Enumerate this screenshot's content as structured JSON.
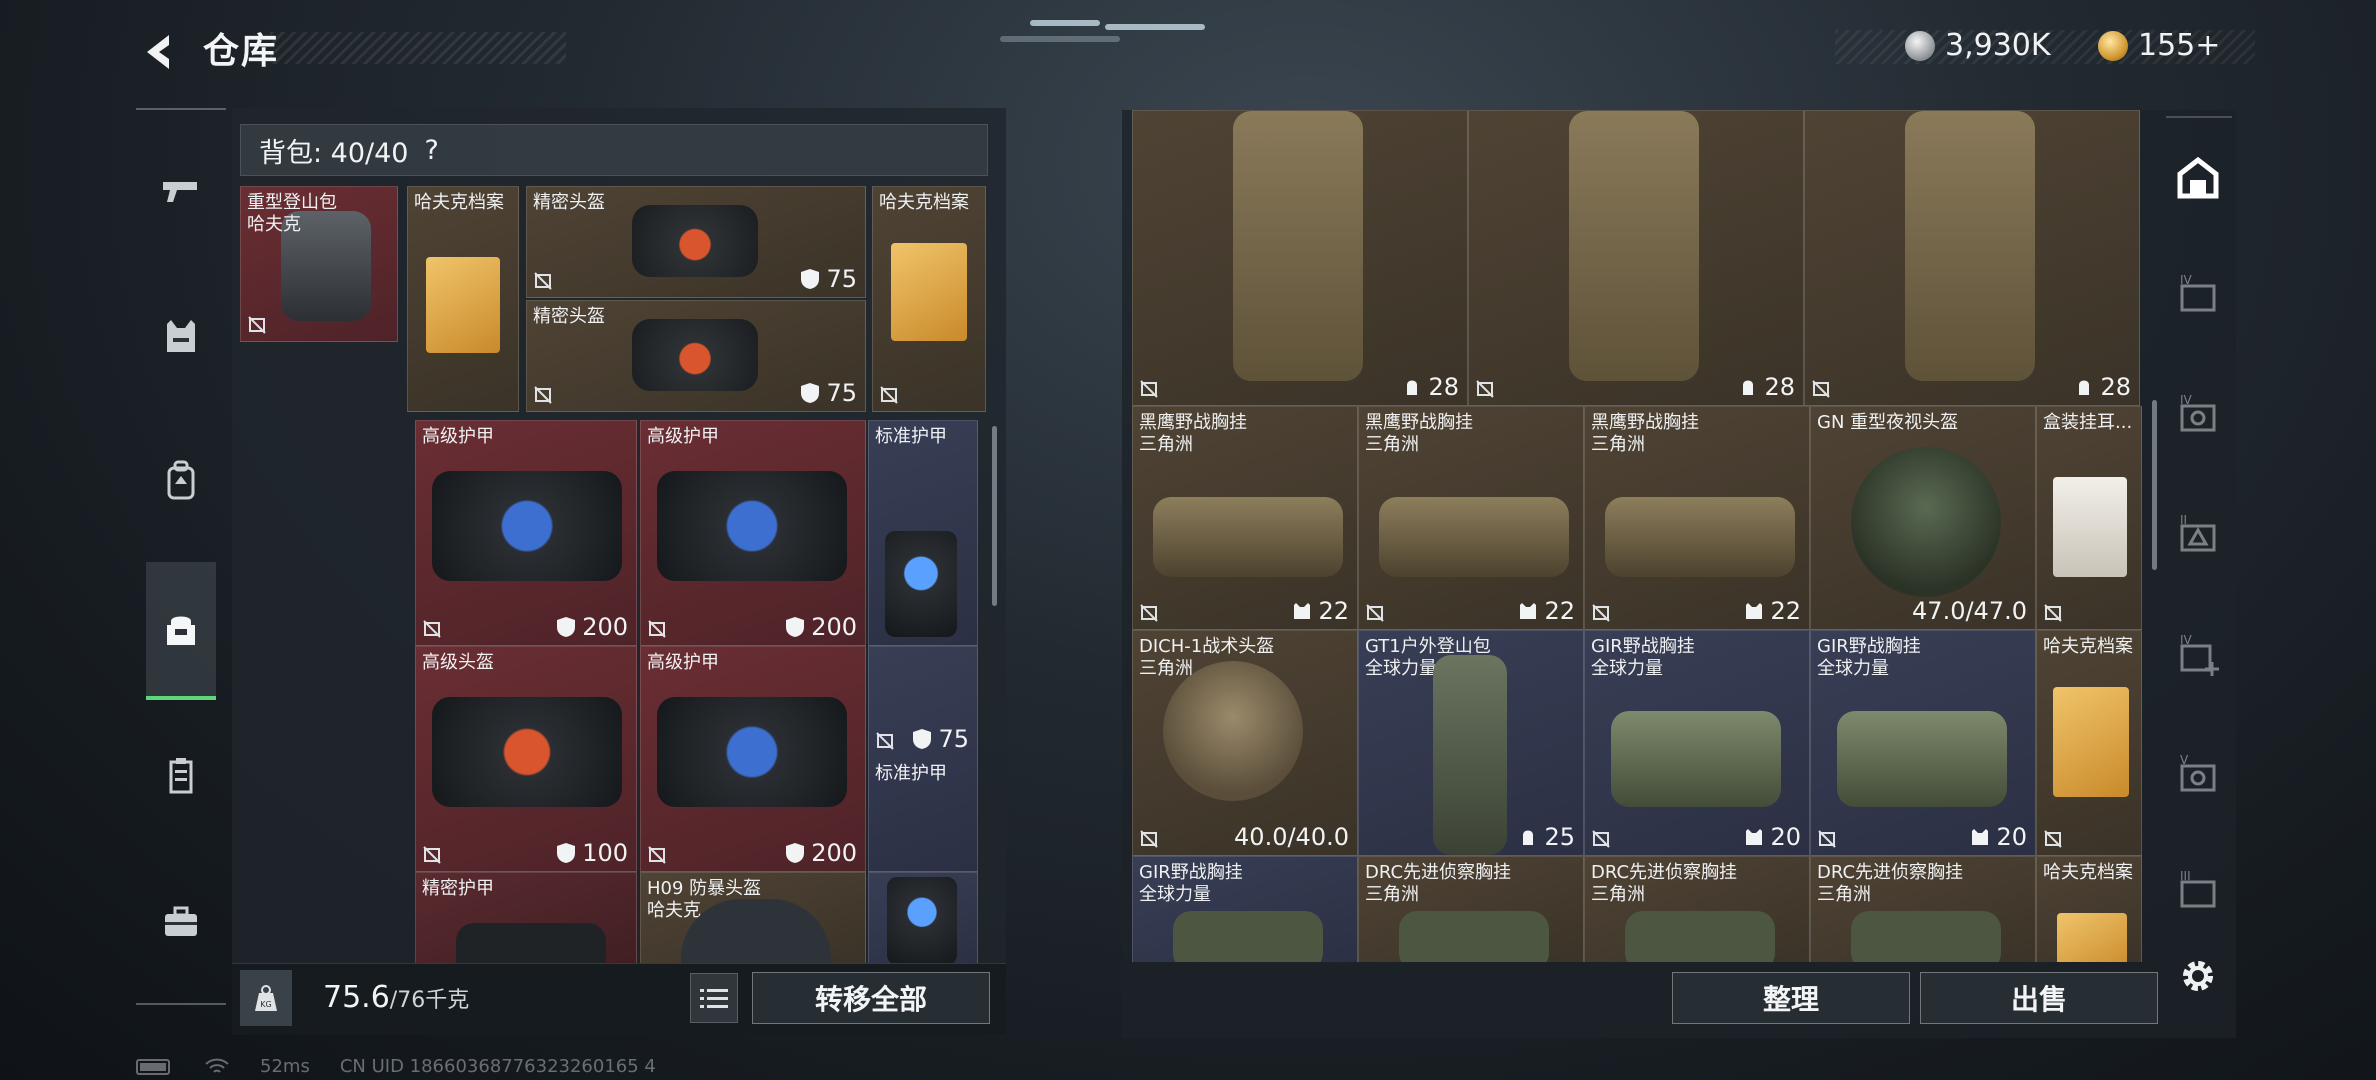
{
  "header": {
    "title": "仓库"
  },
  "currency": {
    "silver": "3,930K",
    "gold": "155+"
  },
  "bag": {
    "label": "背包: 40/40",
    "help": "?"
  },
  "left_items": [
    {
      "name": "重型登山包\n哈夫克",
      "value": ""
    },
    {
      "name": "哈夫克档案",
      "value": ""
    },
    {
      "name": "精密头盔",
      "value": "75"
    },
    {
      "name": "精密头盔",
      "value": "75"
    },
    {
      "name": "哈夫克档案",
      "value": ""
    },
    {
      "name": "高级护甲",
      "value": "200"
    },
    {
      "name": "高级护甲",
      "value": "200"
    },
    {
      "name": "标准护甲",
      "value": ""
    },
    {
      "name": "高级头盔",
      "value": "100"
    },
    {
      "name": "高级护甲",
      "value": "200"
    },
    {
      "name": "标准护甲",
      "value": "75"
    },
    {
      "name": "精密护甲",
      "value": ""
    },
    {
      "name": "H09 防暴头盔\n哈夫克",
      "value": ""
    }
  ],
  "right_items": [
    {
      "name": "",
      "value": "28"
    },
    {
      "name": "",
      "value": "28"
    },
    {
      "name": "",
      "value": "28"
    },
    {
      "name": "黑鹰野战胸挂\n三角洲",
      "value": "22"
    },
    {
      "name": "黑鹰野战胸挂\n三角洲",
      "value": "22"
    },
    {
      "name": "黑鹰野战胸挂\n三角洲",
      "value": "22"
    },
    {
      "name": "GN 重型夜视头盔",
      "value": "47.0/47.0"
    },
    {
      "name": "盒装挂耳...",
      "value": ""
    },
    {
      "name": "DICH-1战术头盔\n三角洲",
      "value": "40.0/40.0"
    },
    {
      "name": "GT1户外登山包\n全球力量",
      "value": "25"
    },
    {
      "name": "GIR野战胸挂\n全球力量",
      "value": "20"
    },
    {
      "name": "GIR野战胸挂\n全球力量",
      "value": "20"
    },
    {
      "name": "哈夫克档案",
      "value": ""
    },
    {
      "name": "GIR野战胸挂\n全球力量",
      "value": ""
    },
    {
      "name": "DRC先进侦察胸挂\n三角洲",
      "value": ""
    },
    {
      "name": "DRC先进侦察胸挂\n三角洲",
      "value": ""
    },
    {
      "name": "DRC先进侦察胸挂\n三角洲",
      "value": ""
    },
    {
      "name": "哈夫克档案",
      "value": ""
    }
  ],
  "weight": {
    "value": "75.6",
    "unit": "/76千克"
  },
  "buttons": {
    "transfer_all": "转移全部",
    "organize": "整理",
    "sell": "出售"
  },
  "status": {
    "ping": "52ms",
    "uid": "CN UID 18660368776323260165 4"
  },
  "colors": {
    "rarity_red": "#6a2e33",
    "rarity_gold": "#4f4334",
    "rarity_blue": "#383e55",
    "accent_green": "#5fd67a"
  }
}
